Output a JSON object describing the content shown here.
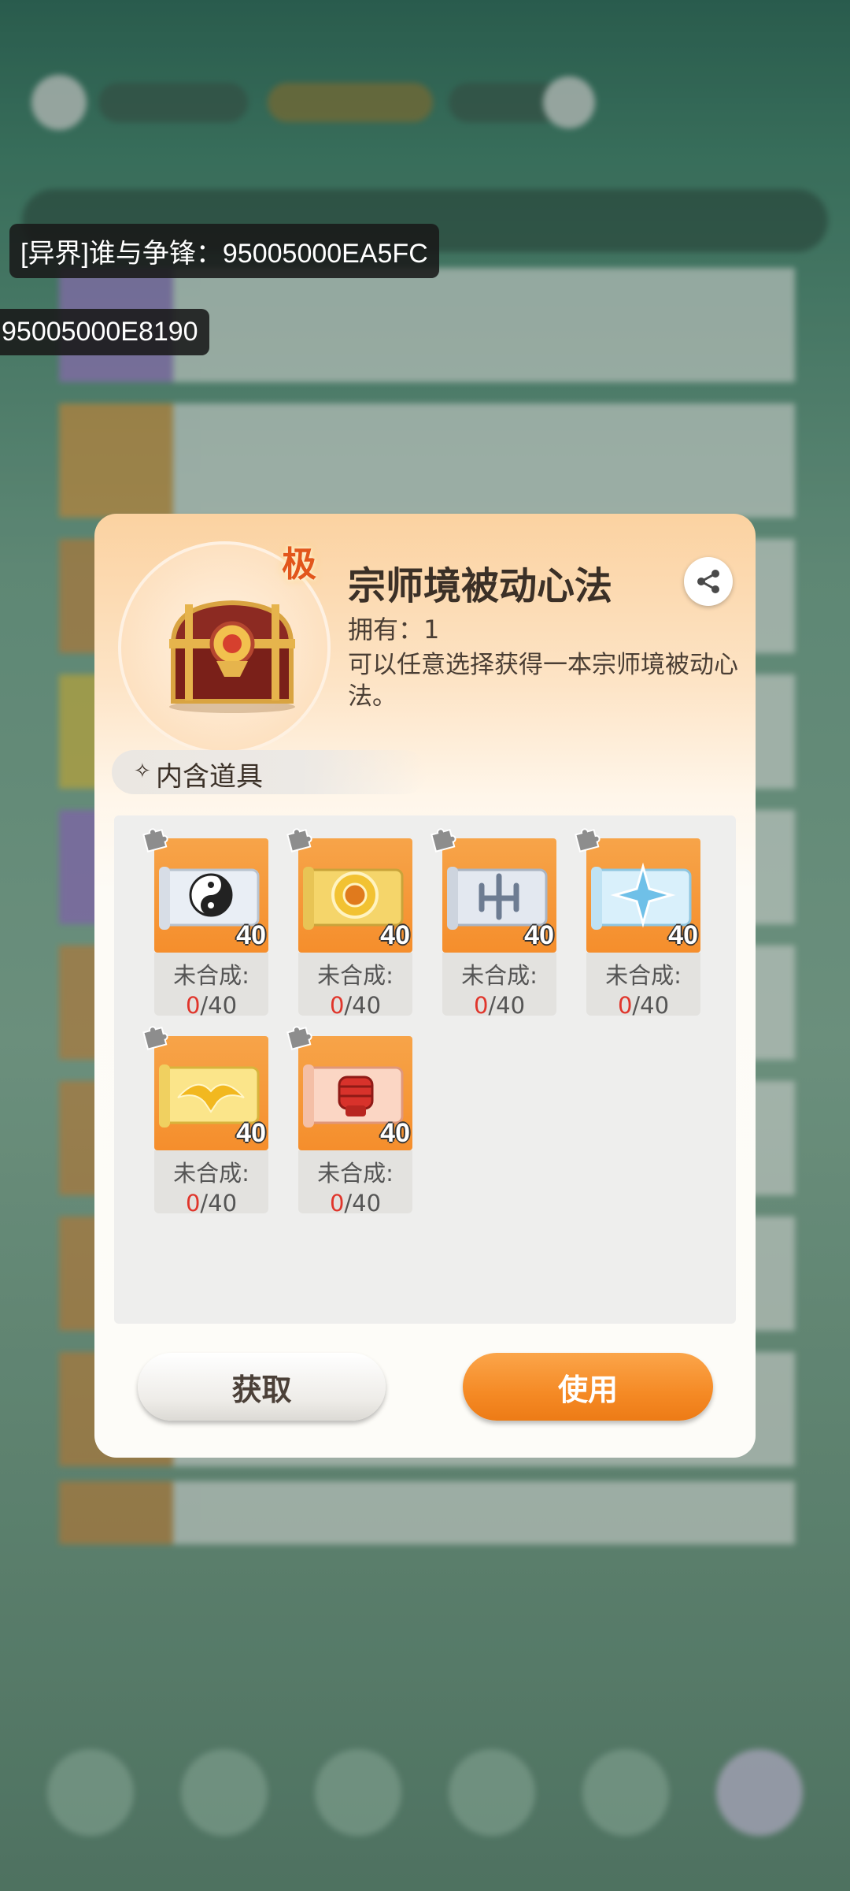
{
  "overlay_tags": {
    "tag1": "[异界]谁与争锋：95005000EA5FC",
    "tag2": "95005000E8190"
  },
  "dialog": {
    "grade_badge": "极",
    "title": "宗师境被动心法",
    "owned": "拥有：1",
    "description": "可以任意选择获得一本宗师境被动心法。",
    "share_icon": "share-icon",
    "section_label": "内含道具",
    "items": [
      {
        "count": "40",
        "status_label": "未合成:",
        "current": "0",
        "total": "/40",
        "art": "yin-yang-scroll"
      },
      {
        "count": "40",
        "status_label": "未合成:",
        "current": "0",
        "total": "/40",
        "art": "gold-emblem-scroll"
      },
      {
        "count": "40",
        "status_label": "未合成:",
        "current": "0",
        "total": "/40",
        "art": "silver-trident-scroll"
      },
      {
        "count": "40",
        "status_label": "未合成:",
        "current": "0",
        "total": "/40",
        "art": "ice-star-scroll"
      },
      {
        "count": "40",
        "status_label": "未合成:",
        "current": "0",
        "total": "/40",
        "art": "golden-eagle-scroll"
      },
      {
        "count": "40",
        "status_label": "未合成:",
        "current": "0",
        "total": "/40",
        "art": "red-fist-scroll"
      }
    ],
    "get_button": "获取",
    "use_button": "使用"
  },
  "colors": {
    "accent": "#f58a25",
    "count_red": "#e0352b",
    "text": "#3b3027"
  }
}
